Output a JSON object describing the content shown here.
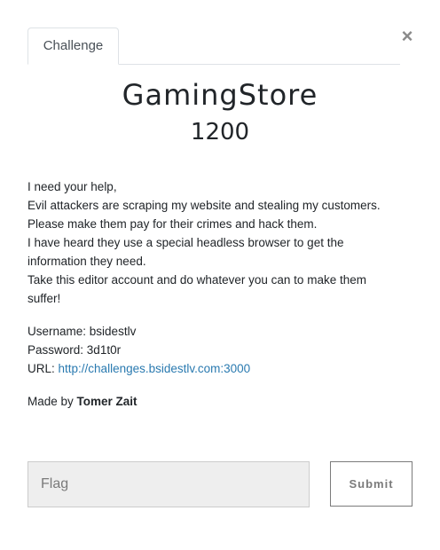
{
  "modal": {
    "close_glyph": "×",
    "tab_label": "Challenge",
    "challenge_name": "GamingStore",
    "points": "1200",
    "description_lines": [
      "I need your help,",
      "Evil attackers are scraping my website and stealing my customers.",
      "Please make them pay for their crimes and hack them.",
      "I have heard they use a special headless browser to get the information they need.",
      "Take this editor account and do whatever you can to make them suffer!"
    ],
    "credentials": {
      "username_label": "Username:",
      "username": "bsidestlv",
      "password_label": "Password:",
      "password": "3d1t0r",
      "url_label": "URL:",
      "url": "http://challenges.bsidestlv.com:3000"
    },
    "author_prefix": "Made by",
    "author_name": "Tomer Zait"
  },
  "form": {
    "flag_placeholder": "Flag",
    "flag_value": "",
    "submit_label": "Submit"
  }
}
